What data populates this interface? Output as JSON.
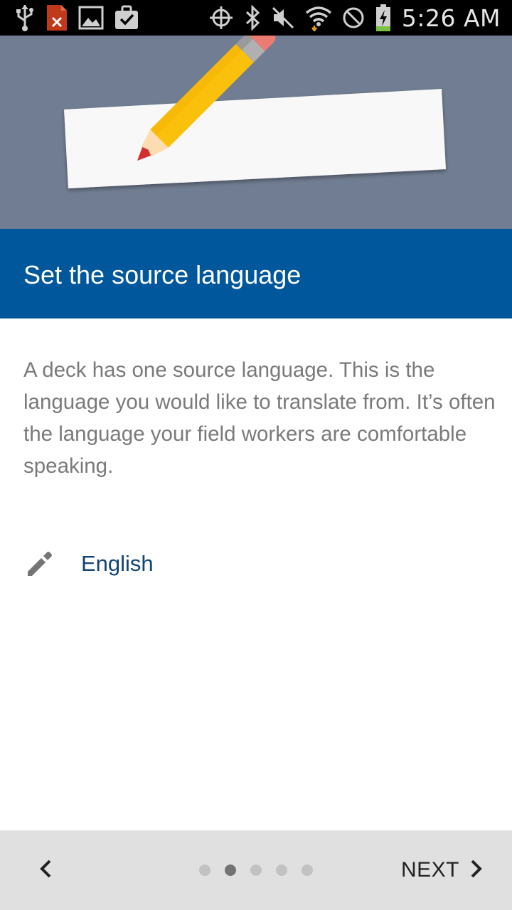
{
  "status_bar": {
    "time": "5:26 AM",
    "left_icons": [
      "usb-icon",
      "file-error-icon",
      "gallery-icon",
      "briefcase-check-icon"
    ],
    "right_icons": [
      "gps-icon",
      "bluetooth-icon",
      "mute-icon",
      "wifi-icon",
      "blocked-icon",
      "battery-charging-icon"
    ]
  },
  "header": {
    "title": "Set the source language"
  },
  "body": {
    "description": "A deck has one source language. This is the language you would like to translate from. It’s often the language your field workers are comfortable speaking.",
    "source_language": "English"
  },
  "footer": {
    "next_label": "NEXT",
    "page_count": 5,
    "active_page": 2
  },
  "colors": {
    "hero_background": "#717d92",
    "title_band": "#01579b",
    "language_text": "#114473"
  }
}
